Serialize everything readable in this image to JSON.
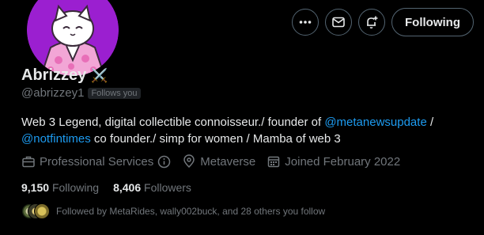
{
  "profile": {
    "display_name": "Abrizzey",
    "name_emoji": "⚔️",
    "handle": "@abrizzey1",
    "follows_you_label": "Follows you"
  },
  "actions": {
    "more_icon": "more-icon",
    "message_icon": "mail-icon",
    "notify_icon": "bell-plus-icon",
    "following_label": "Following"
  },
  "bio": {
    "part1": "Web 3 Legend, digital collectible connoisseur./ founder of ",
    "mention1": "@metanewsupdate",
    "part2": " /",
    "mention2": "@notfintimes",
    "part3": " co founder./ simp for women / Mamba of web 3"
  },
  "meta": {
    "category": "Professional Services",
    "location": "Metaverse",
    "joined": "Joined February 2022"
  },
  "stats": {
    "following_count": "9,150",
    "following_label": "Following",
    "followers_count": "8,406",
    "followers_label": "Followers"
  },
  "followed_by": {
    "text": "Followed by MetaRides, wally002buck, and 28 others you follow"
  },
  "colors": {
    "background": "#000000",
    "text": "#e7e9ea",
    "muted": "#71767b",
    "link": "#1d9bf0",
    "avatar_bg": "#9b1fd0"
  }
}
